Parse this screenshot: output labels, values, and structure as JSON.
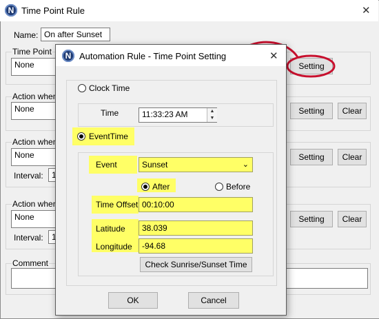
{
  "outer": {
    "title": "Time Point Rule",
    "name_label": "Name:",
    "name_value": "On after Sunset",
    "time_point_label": "Time Point",
    "time_point_value": "None",
    "action1_label": "Action when C",
    "action1_value": "None",
    "action2_label": "Action when C",
    "action2_value": "None",
    "interval_label": "Interval:",
    "interval2_value": "1",
    "action3_label": "Action when C",
    "action3_value": "None",
    "interval3_value": "1",
    "comment_label": "Comment",
    "setting_label": "Setting",
    "clear_label": "Clear"
  },
  "dialog": {
    "title": "Automation Rule - Time Point Setting",
    "clock_time_label": "Clock Time",
    "time_label": "Time",
    "time_value": "11:33:23 AM",
    "event_time_label": "EventTime",
    "event_label": "Event",
    "event_value": "Sunset",
    "after_label": "After",
    "before_label": "Before",
    "time_offset_label": "Time Offset",
    "time_offset_value": "00:10:00",
    "latitude_label": "Latitude",
    "latitude_value": "38.039",
    "longitude_label": "Longitude",
    "longitude_value": "-94.68",
    "check_label": "Check Sunrise/Sunset Time",
    "ok_label": "OK",
    "cancel_label": "Cancel"
  },
  "colors": {
    "highlight": "#ffff66",
    "annotation_red": "#c8102e"
  }
}
